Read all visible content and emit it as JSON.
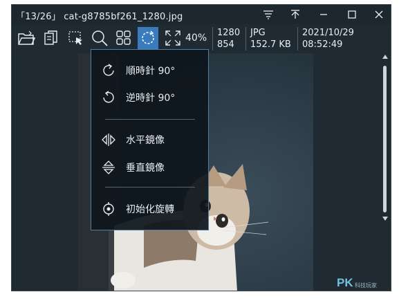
{
  "window": {
    "title": "「13/26」 cat-g8785bf261_1280.jpg"
  },
  "toolbar": {
    "zoom_level": "40%",
    "image_width": "1280",
    "image_height": "854",
    "format": "JPG",
    "file_size": "152.7 KB",
    "date": "2021/10/29",
    "time": "08:52:49",
    "icons": [
      "open-folder-icon",
      "copy-icon",
      "select-region-icon",
      "zoom-icon",
      "thumbnail-grid-icon",
      "rotate-icon",
      "fullscreen-icon"
    ]
  },
  "menu": {
    "items": [
      {
        "label": "順時針 90°",
        "icon": "rotate-clockwise-icon"
      },
      {
        "label": "逆時針 90°",
        "icon": "rotate-counterclockwise-icon"
      },
      {
        "label": "水平鏡像",
        "icon": "flip-horizontal-icon"
      },
      {
        "label": "垂直鏡像",
        "icon": "flip-vertical-icon"
      },
      {
        "label": "初始化旋轉",
        "icon": "reset-rotation-icon"
      }
    ]
  },
  "watermark": {
    "brand": "PK",
    "subtext": "科技玩家"
  },
  "colors": {
    "window_bg": "#1f2a32",
    "accent": "#3a7bbd",
    "menu_border": "#4d7fa6",
    "text": "#e8eef2"
  }
}
